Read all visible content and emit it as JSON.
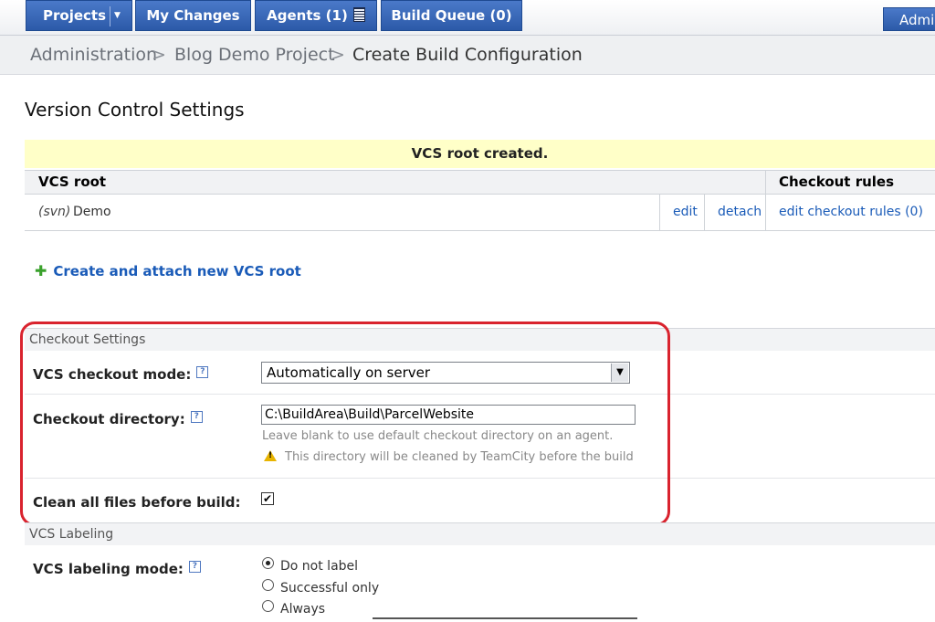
{
  "nav": {
    "projects": "Projects",
    "my_changes": "My Changes",
    "agents": "Agents (1)",
    "build_queue": "Build Queue (0)",
    "admin": "Admin"
  },
  "breadcrumb": {
    "administration": "Administration",
    "sep": ">",
    "project": "Blog Demo Project",
    "current": "Create Build Configuration"
  },
  "section_title": "Version Control Settings",
  "notice": "VCS root created.",
  "vcs_table": {
    "headers": [
      "VCS root",
      "Checkout rules"
    ],
    "rows": [
      {
        "type": "(svn)",
        "name": "Demo",
        "edit": "edit",
        "detach": "detach",
        "rules": "edit checkout rules (0)"
      }
    ]
  },
  "create_link": "Create and attach new VCS root",
  "checkout": {
    "header": "Checkout Settings",
    "mode_label": "VCS checkout mode:",
    "mode_value": "Automatically on server",
    "dir_label": "Checkout directory:",
    "dir_value": "C:\\BuildArea\\Build\\ParcelWebsite",
    "dir_hint": "Leave blank to use default checkout directory on an agent.",
    "dir_warning": "This directory will be cleaned by TeamCity before the build",
    "clean_label": "Clean all files before build:",
    "clean_checked": true
  },
  "labeling": {
    "header": "VCS Labeling",
    "mode_label": "VCS labeling mode:",
    "options": [
      "Do not label",
      "Successful only",
      "Always"
    ],
    "selected": "Do not label"
  }
}
